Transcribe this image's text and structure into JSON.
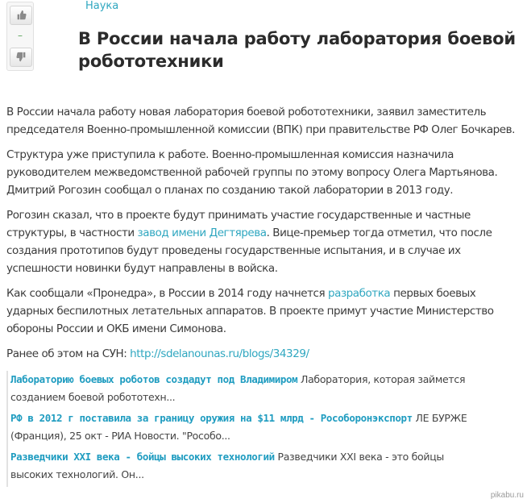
{
  "post": {
    "category": "Наука",
    "rating": "–",
    "title": "В России начала работу лаборатория боевой робототехники"
  },
  "icons": {
    "upvote": "thumbs-up-icon",
    "downvote": "thumbs-down-icon"
  },
  "body": {
    "p1": "В России начала работу новая лаборатория боевой робототехники, заявил заместитель председателя Военно-промышленной комиссии (ВПК) при правительстве РФ Олег Бочкарев.",
    "p2": "Структура уже приступила к работе. Военно-промышленная комиссия назначила руководителем межведомственной рабочей группы по этому вопросу Олега Мартьянова. Дмитрий Рогозин сообщал о планах по созданию такой лаборатории в 2013 году.",
    "p3_before": "Рогозин сказал, что в проекте будут принимать участие государственные и частные структуры, в частности ",
    "p3_link": "завод имени Дегтярева",
    "p3_after": ". Вице-премьер тогда отметил, что после создания прототипов будут проведены государственные испытания, и в случае их успешности новинки будут направлены в войска.",
    "p4_before": "Как сообщали «Пронедра», в России в 2014 году начнется ",
    "p4_link": "разработка",
    "p4_after": " первых боевых ударных беспилотных летательных аппаратов. В проекте примут участие Министерство обороны России и ОКБ имени Симонова.",
    "p5_before": "Ранее об этом на СУН: ",
    "p5_link": "http://sdelanounas.ru/blogs/34329/"
  },
  "related": [
    {
      "link": "Лабораторию боевых роботов создадут под Владимиром",
      "snippet": " Лаборатория, которая займется созданием боевой робототехн..."
    },
    {
      "link": "РФ в 2012 г поставила за границу оружия на $11 млрд - Рособоронэкспорт",
      "snippet": " ЛЕ БУРЖЕ (Франция), 25 окт - РИА Новости. \"Рособо..."
    },
    {
      "link": "Разведчики XXI века - бойцы высоких технологий",
      "snippet": " Разведчики XXI века - это бойцы высоких технологий. Он..."
    }
  ],
  "watermark": "pikabu.ru",
  "colors": {
    "link": "#2fa7c0",
    "rating": "#5aa25a",
    "title": "#2b2b2b"
  }
}
